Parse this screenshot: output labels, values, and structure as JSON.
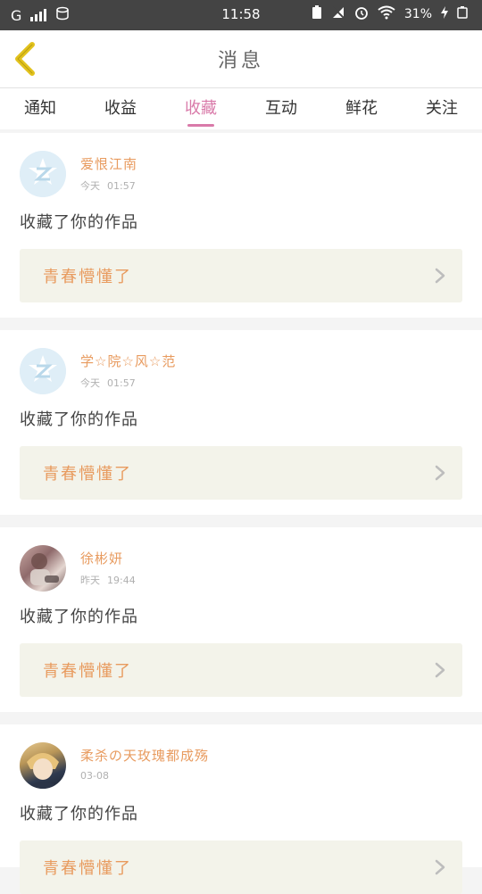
{
  "status_bar": {
    "carrier": "G",
    "time": "11:58",
    "battery": "31%"
  },
  "header": {
    "title": "消息"
  },
  "tabs": [
    {
      "label": "通知",
      "active": false
    },
    {
      "label": "收益",
      "active": false
    },
    {
      "label": "收藏",
      "active": true
    },
    {
      "label": "互动",
      "active": false
    },
    {
      "label": "鲜花",
      "active": false
    },
    {
      "label": "关注",
      "active": false
    }
  ],
  "messages": [
    {
      "username": "爱恨江南",
      "day": "今天",
      "clock": "01:57",
      "avatar": "default-avatar",
      "text": "收藏了你的作品",
      "work_title": "青春懵懂了"
    },
    {
      "username": "学☆院☆风☆范",
      "day": "今天",
      "clock": "01:57",
      "avatar": "default-avatar",
      "text": "收藏了你的作品",
      "work_title": "青春懵懂了"
    },
    {
      "username": "徐彬妍",
      "day": "昨天",
      "clock": "19:44",
      "avatar": "photo-avatar",
      "text": "收藏了你的作品",
      "work_title": "青春懵懂了"
    },
    {
      "username": "柔杀の天玫瑰都成殇",
      "day": "03-08",
      "clock": "",
      "avatar": "photo-avatar",
      "text": "收藏了你的作品",
      "work_title": "青春懵懂了"
    }
  ],
  "colors": {
    "accent": "#d97aa9",
    "username": "#e89b5f",
    "back_icon": "#e2c21c"
  }
}
